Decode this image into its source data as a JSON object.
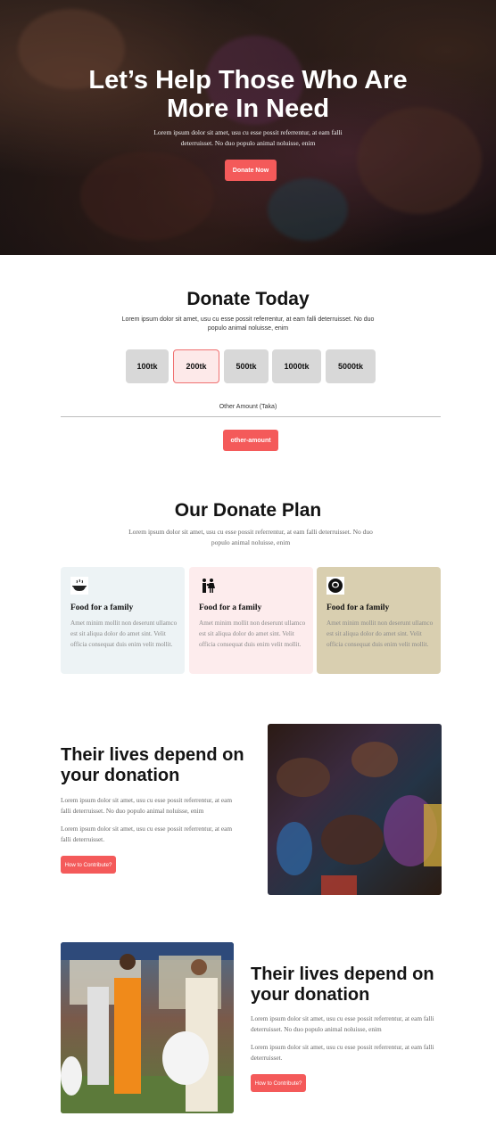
{
  "hero": {
    "title_line1": "Let’s Help Those Who Are",
    "title_line2": "More In Need",
    "text": "Lorem ipsum dolor sit amet, usu cu esse possit referrentur, at eam falli deterruisset. No duo populo animal noluisse, enim",
    "button": "Donate Now"
  },
  "donate": {
    "title": "Donate Today",
    "subtitle": "Lorem ipsum dolor sit amet, usu cu esse possit referrentur, at eam falli deterruisset. No duo populo animal noluisse, enim",
    "amounts": [
      "100tk",
      "200tk",
      "500tk",
      "1000tk",
      "5000tk"
    ],
    "selected_amount": "200tk",
    "other_label": "Other Amount (Taka)",
    "other_button": "other-amount"
  },
  "plan": {
    "title": "Our Donate Plan",
    "subtitle": "Lorem ipsum dolor sit amet, usu cu esse possit referrentur, at eam falli deterruisset. No duo populo animal noluisse, enim",
    "cards": [
      {
        "icon": "food-bowl-icon",
        "title": "Food for a family",
        "text": "Amet minim mollit non deserunt ullamco est sit aliqua dolor do amet sint. Velit officia consequat duis enim velit mollit.",
        "bg": "#edf3f5"
      },
      {
        "icon": "family-icon",
        "title": "Food for a family",
        "text": "Amet minim mollit non deserunt ullamco est sit aliqua dolor do amet sint. Velit officia consequat duis enim velit mollit.",
        "bg": "#fdeced"
      },
      {
        "icon": "hijab-person-icon",
        "title": "Food for a family",
        "text": "Amet minim mollit non deserunt ullamco est sit aliqua dolor do amet sint. Velit officia consequat duis enim velit mollit.",
        "bg": "#d9cfb0"
      }
    ]
  },
  "lives1": {
    "title_line1": "Their lives depend on",
    "title_line2": "your donation",
    "p1": "Lorem ipsum dolor sit amet, usu cu esse possit referrentur, at eam falli deterruisset. No duo populo animal noluisse, enim",
    "p2": "Lorem ipsum dolor sit amet, usu cu esse possit referrentur, at eam falli deterruisset.",
    "button": "How to Contribute?"
  },
  "lives2": {
    "title_line1": "Their lives depend on",
    "title_line2": "your donation",
    "p1": "Lorem ipsum dolor sit amet, usu cu esse possit referrentur, at eam falli deterruisset. No duo populo animal noluisse, enim",
    "p2": "Lorem ipsum dolor sit amet, usu cu esse possit referrentur, at eam falli deterruisset.",
    "button": "How to Contribute?"
  },
  "colors": {
    "accent": "#f45a5a",
    "selected_bg": "#fde9e9",
    "amount_bg": "#d8d8d8"
  }
}
